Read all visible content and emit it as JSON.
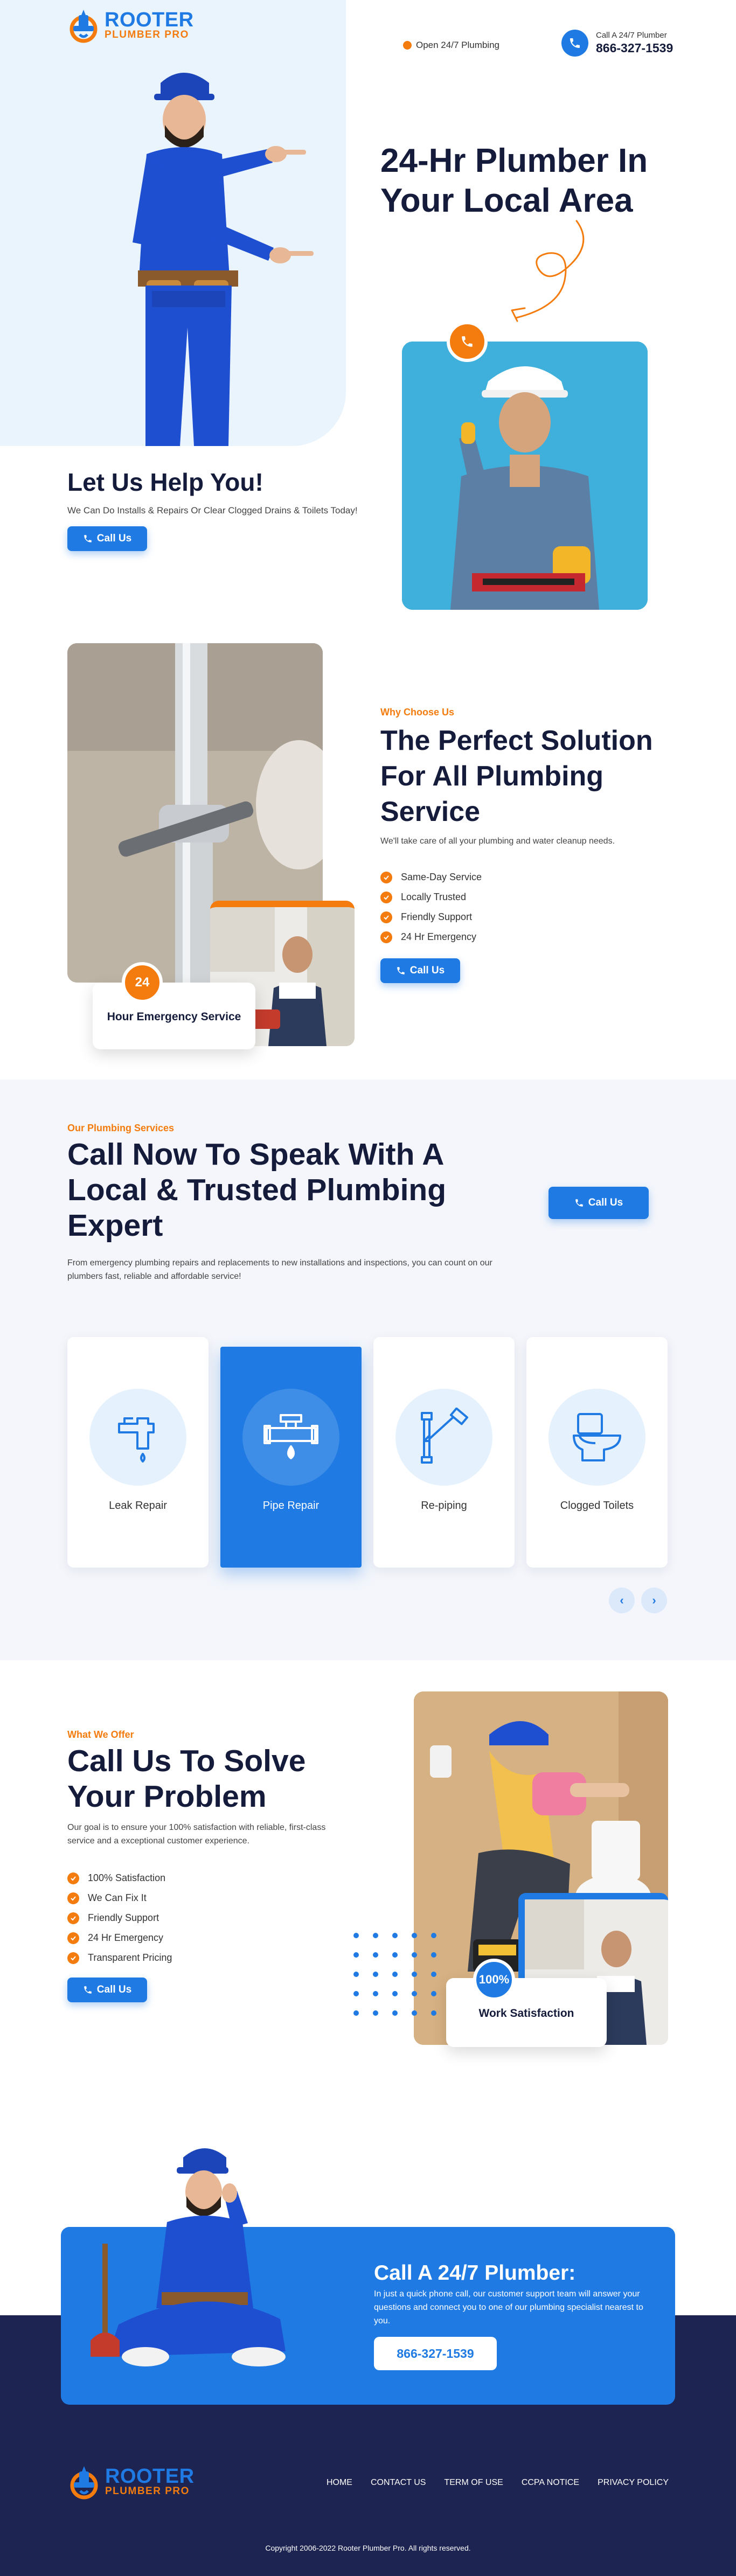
{
  "brand": {
    "name_top": "ROOTER",
    "name_bottom": "PLUMBER PRO",
    "primary": "#1f7be3",
    "accent": "#f47c0e",
    "navy": "#1d2451"
  },
  "header": {
    "open_label": "Open 24/7 Plumbing",
    "call_small": "Call A 24/7 Plumber",
    "phone": "866-327-1539"
  },
  "hero": {
    "title": "24-Hr Plumber In Your Local Area",
    "help_title": "Let Us Help You!",
    "help_sub": "We Can Do Installs & Repairs Or Clear Clogged Drains & Toilets Today!",
    "call_label": "Call Us"
  },
  "why": {
    "eyebrow": "Why Choose Us",
    "title": "The Perfect Solution For All Plumbing Service",
    "sub": "We'll take care of all your plumbing and water cleanup needs.",
    "features": [
      "Same-Day Service",
      "Locally Trusted",
      "Friendly Support",
      "24 Hr Emergency"
    ],
    "call_label": "Call Us",
    "badge_number": "24",
    "badge_text": "Hour Emergency Service"
  },
  "services": {
    "eyebrow": "Our Plumbing Services",
    "title": "Call Now To Speak With A Local & Trusted Plumbing Expert",
    "sub": "From emergency plumbing repairs and replacements to new installations and inspections, you can count on our plumbers fast, reliable and affordable service!",
    "call_label": "Call Us",
    "cards": [
      {
        "label": "Leak Repair",
        "icon": "faucet-icon"
      },
      {
        "label": "Pipe Repair",
        "icon": "pipe-icon"
      },
      {
        "label": "Re-piping",
        "icon": "pipe-elbow-icon"
      },
      {
        "label": "Clogged Toilets",
        "icon": "toilet-icon"
      }
    ],
    "active_index": 1,
    "prev_label": "‹",
    "next_label": "›"
  },
  "offer": {
    "eyebrow": "What We Offer",
    "title": "Call Us To Solve Your Problem",
    "sub": "Our goal is to ensure your 100% satisfaction with reliable, first-class service and a exceptional customer experience.",
    "features": [
      "100% Satisfaction",
      "We Can Fix It",
      "Friendly Support",
      "24 Hr Emergency",
      "Transparent Pricing"
    ],
    "call_label": "Call Us",
    "badge_number": "100%",
    "badge_text": "Work Satisfaction"
  },
  "cta": {
    "title": "Call A 24/7 Plumber:",
    "text": "In just a quick phone call, our customer support team will answer your questions and connect you to one of our plumbing specialist nearest to you.",
    "phone": "866-327-1539"
  },
  "footer": {
    "links": [
      "HOME",
      "CONTACT US",
      "TERM OF USE",
      "CCPA NOTICE",
      "PRIVACY POLICY"
    ],
    "copyright": "Copyright 2006-2022 Rooter Plumber Pro. All rights reserved."
  }
}
